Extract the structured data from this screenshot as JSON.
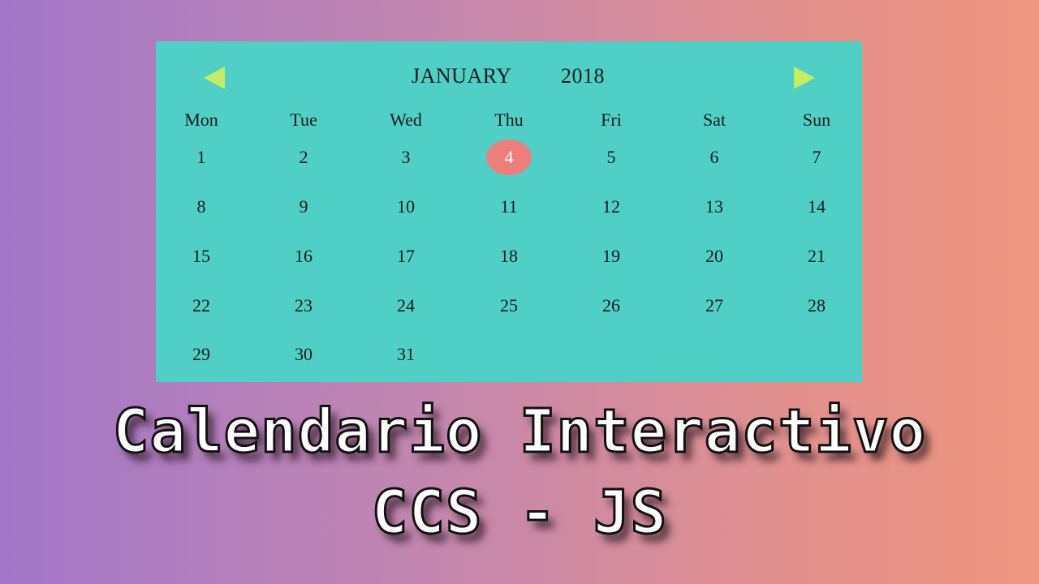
{
  "calendar": {
    "month": "JANUARY",
    "year": "2018",
    "prev_icon": "triangle-left",
    "next_icon": "triangle-right",
    "weekdays": [
      "Mon",
      "Tue",
      "Wed",
      "Thu",
      "Fri",
      "Sat",
      "Sun"
    ],
    "days": [
      "1",
      "2",
      "3",
      "4",
      "5",
      "6",
      "7",
      "8",
      "9",
      "10",
      "11",
      "12",
      "13",
      "14",
      "15",
      "16",
      "17",
      "18",
      "19",
      "20",
      "21",
      "22",
      "23",
      "24",
      "25",
      "26",
      "27",
      "28",
      "29",
      "30",
      "31"
    ],
    "today": "4",
    "colors": {
      "panel": "#4fcfc6",
      "arrow": "#c6ec61",
      "today_marker": "#ec7f7c"
    }
  },
  "title": {
    "line1": "Calendario Interactivo",
    "line2": "CCS - JS"
  }
}
